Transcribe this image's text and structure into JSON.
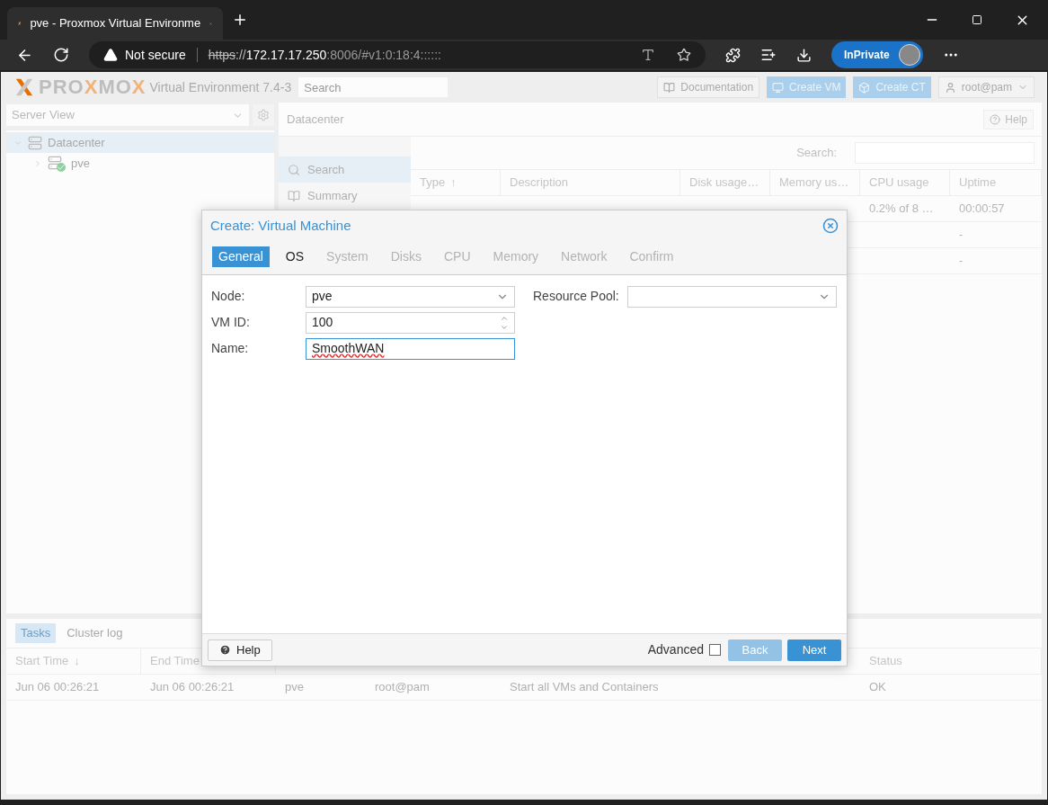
{
  "browser": {
    "tab_title": "pve - Proxmox Virtual Environme",
    "security": "Not secure",
    "url_scheme": "https",
    "url_separator": "://",
    "url_host": "172.17.17.250",
    "url_rest": ":8006/#v1:0:18:4::::::",
    "profile": "InPrivate"
  },
  "header": {
    "logo_parts": [
      {
        "text": "PRO",
        "accent": false
      },
      {
        "text": "X",
        "accent": true
      },
      {
        "text": "MO",
        "accent": false
      },
      {
        "text": "X",
        "accent": true
      }
    ],
    "version": "Virtual Environment 7.4-3",
    "search_placeholder": "Search",
    "buttons": [
      {
        "kind": "docs",
        "label": "Documentation"
      },
      {
        "kind": "vm",
        "label": "Create VM"
      },
      {
        "kind": "ct",
        "label": "Create CT"
      }
    ],
    "user": "root@pam"
  },
  "sidebar": {
    "view": "Server View",
    "tree": [
      {
        "kind": "datacenter",
        "label": "Datacenter",
        "selected": true,
        "expanded": true,
        "children": [
          {
            "kind": "node",
            "label": "pve",
            "selected": false,
            "expanded": false
          }
        ]
      }
    ]
  },
  "main": {
    "title": "Datacenter",
    "help": "Help",
    "nav": [
      {
        "kind": "search",
        "label": "Search",
        "selected": true
      },
      {
        "kind": "summary",
        "label": "Summary",
        "selected": false
      }
    ],
    "search_label": "Search:",
    "columns": [
      {
        "label": "Type",
        "sort_arrow": "↑"
      },
      {
        "label": "Description"
      },
      {
        "label": "Disk usage…"
      },
      {
        "label": "Memory us…"
      },
      {
        "label": "CPU usage"
      },
      {
        "label": "Uptime"
      }
    ],
    "rows": [
      {
        "cpu": "0.2% of 8 …",
        "uptime": "00:00:57"
      },
      {
        "uptime": "-"
      },
      {
        "uptime": "-"
      }
    ]
  },
  "tasks": {
    "tabs": [
      {
        "label": "Tasks",
        "selected": true
      },
      {
        "label": "Cluster log",
        "selected": false
      }
    ],
    "columns": {
      "start_time": {
        "label": "Start Time",
        "sort_arrow": "↓"
      },
      "end_time": {
        "label": "End Time"
      },
      "status": {
        "label": "Status"
      }
    },
    "rows": [
      {
        "start_time": "Jun 06 00:26:21",
        "end_time": "Jun 06 00:26:21",
        "node": "pve",
        "user_name": "root@pam",
        "description": "Start all VMs and Containers",
        "status": "OK"
      }
    ]
  },
  "dialog": {
    "title": "Create: Virtual Machine",
    "tabs": [
      {
        "label": "General",
        "selected": true,
        "disabled": false
      },
      {
        "label": "OS",
        "selected": false,
        "disabled": false
      },
      {
        "label": "System",
        "selected": false,
        "disabled": true
      },
      {
        "label": "Disks",
        "selected": false,
        "disabled": true
      },
      {
        "label": "CPU",
        "selected": false,
        "disabled": true
      },
      {
        "label": "Memory",
        "selected": false,
        "disabled": true
      },
      {
        "label": "Network",
        "selected": false,
        "disabled": true
      },
      {
        "label": "Confirm",
        "selected": false,
        "disabled": true
      }
    ],
    "left_fields": [
      {
        "kind": "select",
        "label": "Node:",
        "value": "pve",
        "focused": false
      },
      {
        "kind": "spinner",
        "label": "VM ID:",
        "value": "100",
        "focused": false
      },
      {
        "kind": "text",
        "label": "Name:",
        "value": "SmoothWAN",
        "focused": true
      }
    ],
    "right_fields": [
      {
        "kind": "select",
        "label": "Resource Pool:",
        "focused": false
      }
    ],
    "help": "Help",
    "advanced": {
      "label": "Advanced",
      "checked": false
    },
    "back": {
      "label": "Back",
      "disabled": true
    },
    "next": {
      "label": "Next",
      "disabled": false
    }
  }
}
